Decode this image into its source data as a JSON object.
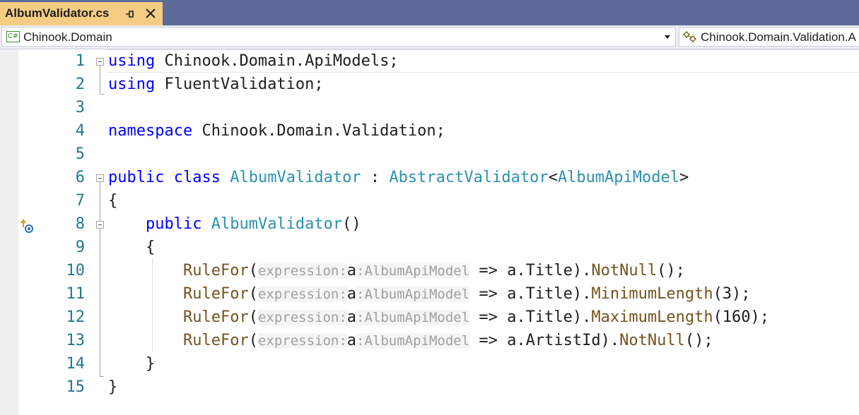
{
  "tab": {
    "title": "AlbumValidator.cs"
  },
  "navbar": {
    "project_icon": "C#",
    "project": "Chinook.Domain",
    "type_scope": "Chinook.Domain.Validation.A"
  },
  "editor": {
    "lines": [
      {
        "num": "1",
        "tokens": [
          {
            "t": "using",
            "c": "kw"
          },
          {
            "t": " Chinook.Domain.ApiModels;",
            "c": ""
          }
        ]
      },
      {
        "num": "2",
        "tokens": [
          {
            "t": "using",
            "c": "kw"
          },
          {
            "t": " FluentValidation;",
            "c": ""
          }
        ]
      },
      {
        "num": "3",
        "tokens": []
      },
      {
        "num": "4",
        "tokens": [
          {
            "t": "namespace",
            "c": "kw"
          },
          {
            "t": " Chinook.Domain.Validation;",
            "c": ""
          }
        ]
      },
      {
        "num": "5",
        "tokens": []
      },
      {
        "num": "6",
        "tokens": [
          {
            "t": "public",
            "c": "kw"
          },
          {
            "t": " ",
            "c": ""
          },
          {
            "t": "class",
            "c": "kw"
          },
          {
            "t": " ",
            "c": ""
          },
          {
            "t": "AlbumValidator",
            "c": "ty"
          },
          {
            "t": " : ",
            "c": ""
          },
          {
            "t": "AbstractValidator",
            "c": "ty"
          },
          {
            "t": "<",
            "c": ""
          },
          {
            "t": "AlbumApiModel",
            "c": "ty"
          },
          {
            "t": ">",
            "c": ""
          }
        ]
      },
      {
        "num": "7",
        "tokens": [
          {
            "t": "{",
            "c": ""
          }
        ]
      },
      {
        "num": "8",
        "tokens": [
          {
            "t": "    ",
            "c": ""
          },
          {
            "t": "public",
            "c": "kw"
          },
          {
            "t": " ",
            "c": ""
          },
          {
            "t": "AlbumValidator",
            "c": "ty"
          },
          {
            "t": "()",
            "c": ""
          }
        ]
      },
      {
        "num": "9",
        "tokens": [
          {
            "t": "    {",
            "c": ""
          }
        ]
      },
      {
        "num": "10",
        "tokens": [
          {
            "t": "        ",
            "c": ""
          },
          {
            "t": "RuleFor",
            "c": "mt"
          },
          {
            "t": "(",
            "c": ""
          },
          {
            "t": "expression:",
            "c": "hint"
          },
          {
            "t": "a",
            "c": ""
          },
          {
            "t": ":AlbumApiModel",
            "c": "hint"
          },
          {
            "t": " => a.Title).",
            "c": ""
          },
          {
            "t": "NotNull",
            "c": "mt"
          },
          {
            "t": "();",
            "c": ""
          }
        ]
      },
      {
        "num": "11",
        "tokens": [
          {
            "t": "        ",
            "c": ""
          },
          {
            "t": "RuleFor",
            "c": "mt"
          },
          {
            "t": "(",
            "c": ""
          },
          {
            "t": "expression:",
            "c": "hint"
          },
          {
            "t": "a",
            "c": ""
          },
          {
            "t": ":AlbumApiModel",
            "c": "hint"
          },
          {
            "t": " => a.Title).",
            "c": ""
          },
          {
            "t": "MinimumLength",
            "c": "mt"
          },
          {
            "t": "(3);",
            "c": ""
          }
        ]
      },
      {
        "num": "12",
        "tokens": [
          {
            "t": "        ",
            "c": ""
          },
          {
            "t": "RuleFor",
            "c": "mt"
          },
          {
            "t": "(",
            "c": ""
          },
          {
            "t": "expression:",
            "c": "hint"
          },
          {
            "t": "a",
            "c": ""
          },
          {
            "t": ":AlbumApiModel",
            "c": "hint"
          },
          {
            "t": " => a.Title).",
            "c": ""
          },
          {
            "t": "MaximumLength",
            "c": "mt"
          },
          {
            "t": "(160);",
            "c": ""
          }
        ]
      },
      {
        "num": "13",
        "tokens": [
          {
            "t": "        ",
            "c": ""
          },
          {
            "t": "RuleFor",
            "c": "mt"
          },
          {
            "t": "(",
            "c": ""
          },
          {
            "t": "expression:",
            "c": "hint"
          },
          {
            "t": "a",
            "c": ""
          },
          {
            "t": ":AlbumApiModel",
            "c": "hint"
          },
          {
            "t": " => a.ArtistId).",
            "c": ""
          },
          {
            "t": "NotNull",
            "c": "mt"
          },
          {
            "t": "();",
            "c": ""
          }
        ]
      },
      {
        "num": "14",
        "tokens": [
          {
            "t": "    }",
            "c": ""
          }
        ]
      },
      {
        "num": "15",
        "tokens": [
          {
            "t": "}",
            "c": ""
          }
        ]
      }
    ]
  }
}
